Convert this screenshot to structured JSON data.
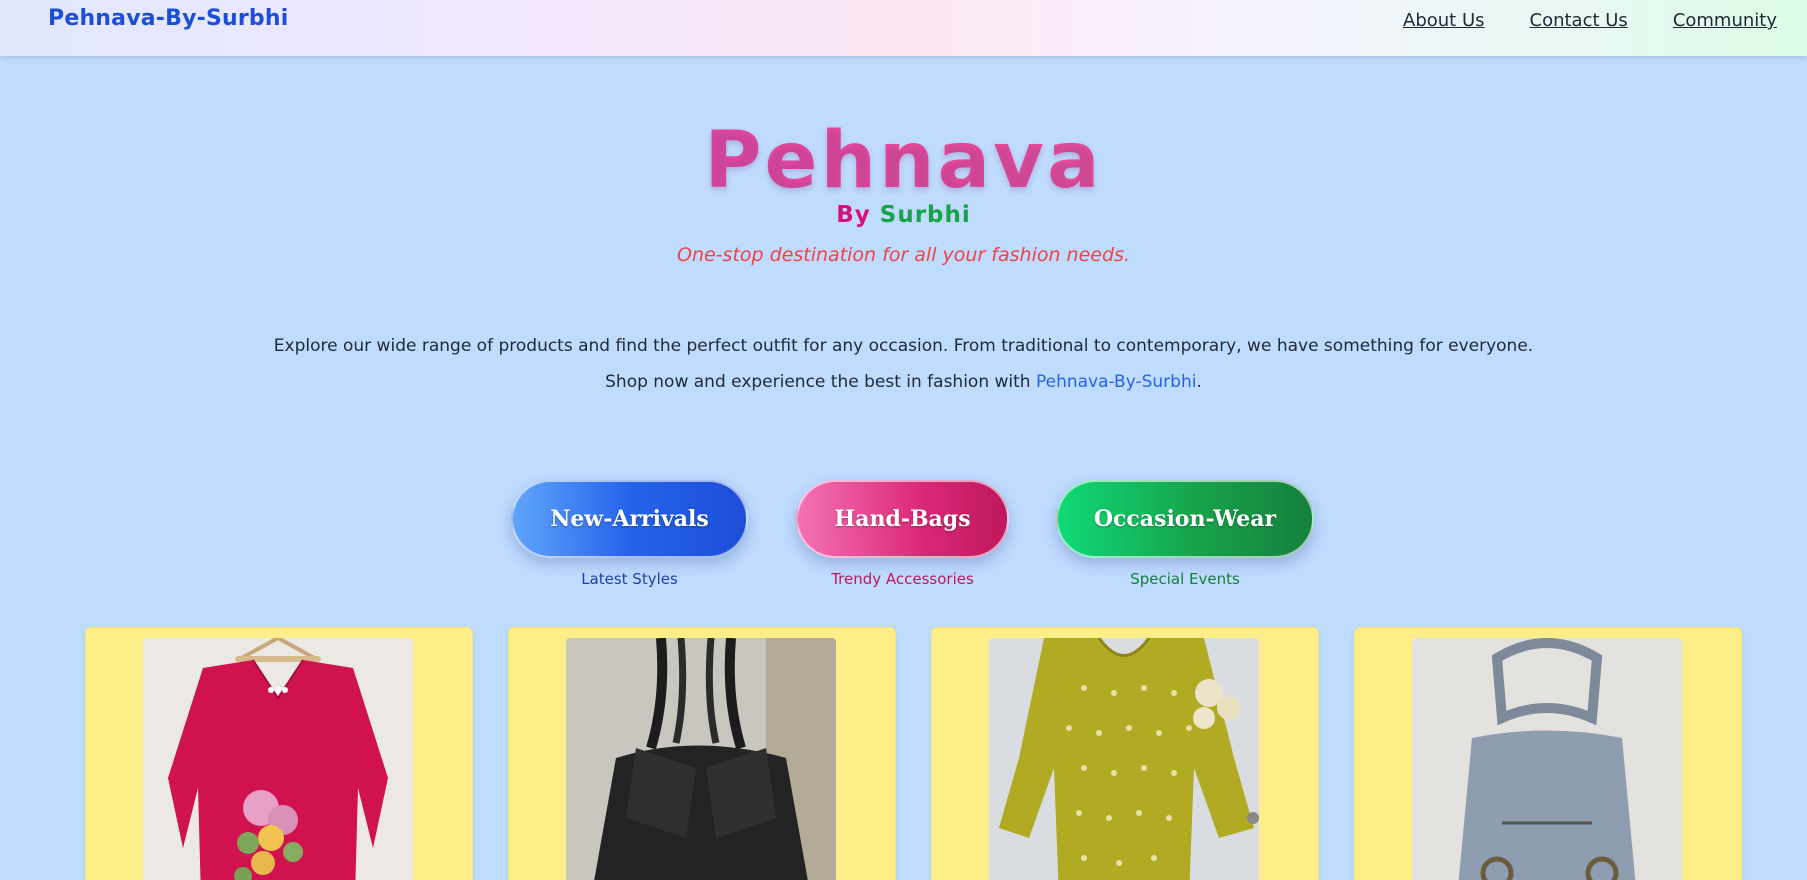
{
  "nav": {
    "brand": "Pehnava-By-Surbhi",
    "links": [
      "About Us",
      "Contact Us",
      "Community"
    ]
  },
  "hero": {
    "title": "Pehnava",
    "sub_by": "By",
    "sub_name": "Surbhi",
    "tagline": "One-stop destination for all your fashion needs.",
    "intro_line1": "Explore our wide range of products and find the perfect outfit for any occasion. From traditional to contemporary, we have something for everyone.",
    "intro_line2_prefix": "Shop now and experience the best in fashion with ",
    "intro_line2_brand": "Pehnava-By-Surbhi",
    "intro_line2_suffix": "."
  },
  "categories": [
    {
      "label": "New-Arrivals",
      "caption": "Latest Styles"
    },
    {
      "label": "Hand-Bags",
      "caption": "Trendy Accessories"
    },
    {
      "label": "Occasion-Wear",
      "caption": "Special Events"
    }
  ],
  "products": [
    {
      "image": "pink-embroidered-kurta"
    },
    {
      "image": "black-studded-handbag"
    },
    {
      "image": "yellow-printed-dress"
    },
    {
      "image": "grey-denim-backpack"
    }
  ],
  "colors": {
    "page_bg": "#bfdbfe",
    "brand_blue": "#1d4ed8",
    "title_pink": "#ec4899",
    "tagline_red": "#ef4444",
    "card_bg": "#fdee87"
  }
}
